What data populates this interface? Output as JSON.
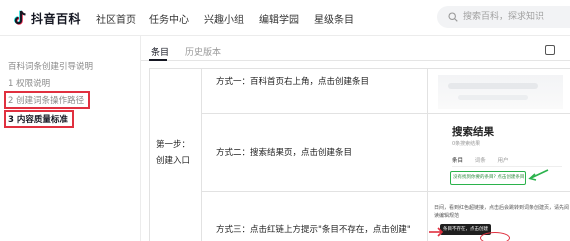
{
  "header": {
    "logo_text": "抖音百科",
    "nav": [
      "社区首页",
      "任务中心",
      "兴趣小组",
      "编辑学园",
      "星级条目"
    ],
    "search_placeholder": "搜索百科，探求知识"
  },
  "sidebar": {
    "title": "百科词条创建引导说明",
    "items": [
      {
        "label": "1 权限说明"
      },
      {
        "label": "2 创建词条操作路径"
      },
      {
        "label": "3 内容质量标准"
      }
    ]
  },
  "main": {
    "tabs": [
      {
        "label": "条目"
      },
      {
        "label": "历史版本"
      }
    ],
    "step_label_line1": "第一步：",
    "step_label_line2": "创建入口",
    "rows": [
      {
        "text": "方式一：百科首页右上角，点击创建条目"
      },
      {
        "text": "方式二：搜索结果页，点击创建条目"
      },
      {
        "text": "方式三：点击红链上方提示\"条目不存在，点击创建\""
      }
    ],
    "image2": {
      "heading": "搜索结果",
      "subtitle": "0条搜索结果",
      "tabs": [
        "条目",
        "词条",
        "用户"
      ],
      "highlight": "没有找到你要的条目? 点击创建条目"
    },
    "image3": {
      "body": "日间，看到红色超链接，点击后会跳转到词条创建页，请先阅读编辑规范",
      "tooltip": "条目不存在，点击创建"
    }
  },
  "colors": {
    "accent_red": "#e0303f",
    "highlight_green": "#2bb24c",
    "text_dark": "#161823",
    "text_muted": "#8a8a8a"
  }
}
